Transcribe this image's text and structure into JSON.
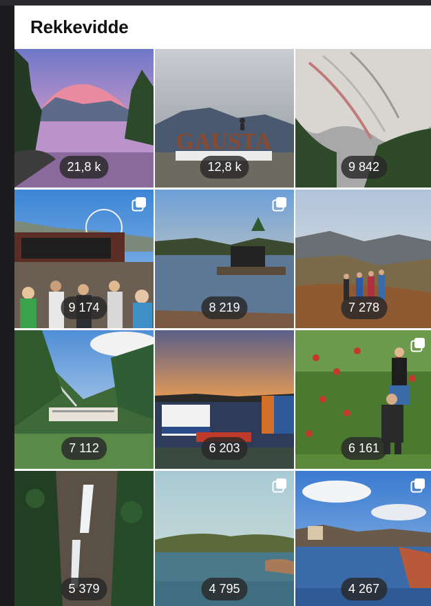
{
  "page": {
    "title": "Rekkevidde"
  },
  "tiles": [
    {
      "reach": "21,8 k",
      "multi": false,
      "subject": "mountain lake at sunset"
    },
    {
      "reach": "12,8 k",
      "multi": false,
      "subject": "GAUSTA sign"
    },
    {
      "reach": "9 842",
      "multi": false,
      "subject": "rock canyon"
    },
    {
      "reach": "9 174",
      "multi": true,
      "subject": "concert crowd"
    },
    {
      "reach": "8 219",
      "multi": true,
      "subject": "lake cabin"
    },
    {
      "reach": "7 278",
      "multi": false,
      "subject": "hikers on ridge"
    },
    {
      "reach": "7 112",
      "multi": false,
      "subject": "power station valley"
    },
    {
      "reach": "6 203",
      "multi": false,
      "subject": "harbor ferry"
    },
    {
      "reach": "6 161",
      "multi": true,
      "subject": "apple picking"
    },
    {
      "reach": "5 379",
      "multi": false,
      "subject": "waterfall"
    },
    {
      "reach": "4 795",
      "multi": true,
      "subject": "calm bay"
    },
    {
      "reach": "4 267",
      "multi": true,
      "subject": "river town"
    }
  ],
  "sign_text": "GAUSTA",
  "icons": {
    "multi": "multiple-images-icon"
  }
}
